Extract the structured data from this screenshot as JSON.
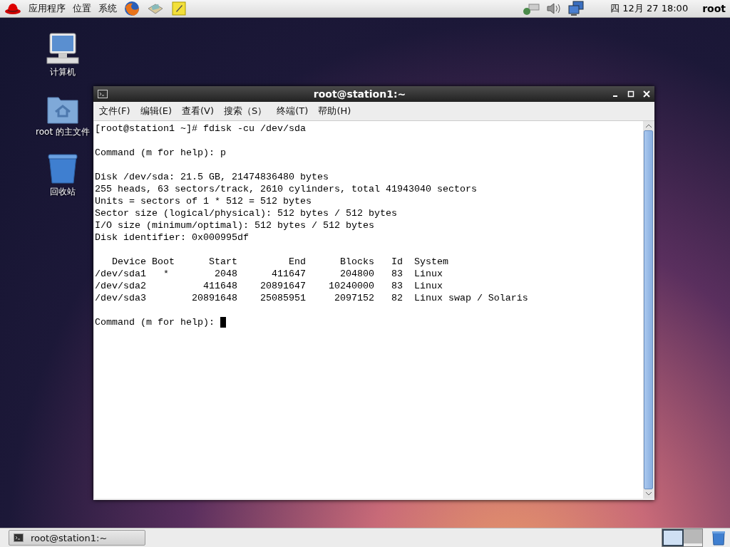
{
  "top_panel": {
    "menus": [
      "应用程序",
      "位置",
      "系统"
    ],
    "clock": "四 12月 27 18:00",
    "user": "root"
  },
  "desktop_icons": [
    {
      "kind": "computer",
      "label": "计算机"
    },
    {
      "kind": "home",
      "label": "root 的主文件"
    },
    {
      "kind": "trash",
      "label": "回收站"
    }
  ],
  "window": {
    "title": "root@station1:~",
    "menu": [
      "文件(F)",
      "编辑(E)",
      "查看(V)",
      "搜索（S）",
      "终端(T)",
      "帮助(H)"
    ],
    "terminal_blocks": [
      [
        "[root@station1 ~]# fdisk -cu /dev/sda"
      ],
      [
        "Command (m for help): p"
      ],
      [
        "Disk /dev/sda: 21.5 GB, 21474836480 bytes",
        "255 heads, 63 sectors/track, 2610 cylinders, total 41943040 sectors",
        "Units = sectors of 1 * 512 = 512 bytes",
        "Sector size (logical/physical): 512 bytes / 512 bytes",
        "I/O size (minimum/optimal): 512 bytes / 512 bytes",
        "Disk identifier: 0x000995df"
      ],
      [
        "   Device Boot      Start         End      Blocks   Id  System",
        "/dev/sda1   *        2048      411647      204800   83  Linux",
        "/dev/sda2          411648    20891647    10240000   83  Linux",
        "/dev/sda3        20891648    25085951     2097152   82  Linux swap / Solaris"
      ],
      [
        "Command (m for help): "
      ]
    ],
    "cursor_visible": true
  },
  "taskbar": {
    "tasks": [
      {
        "label": "root@station1:~",
        "selected": false
      }
    ],
    "workspaces": [
      {
        "selected": true
      },
      {
        "selected": false
      }
    ]
  }
}
